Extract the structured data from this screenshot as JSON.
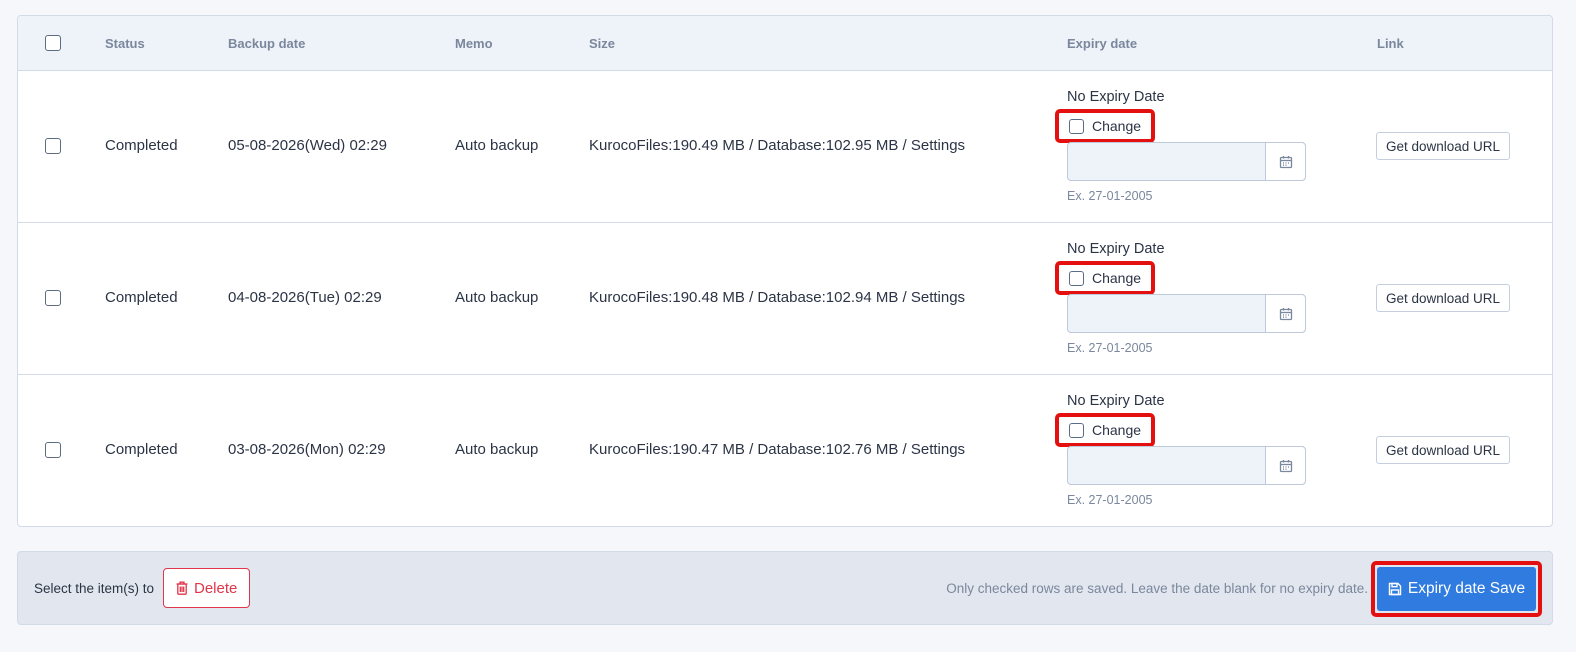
{
  "table": {
    "headers": {
      "status": "Status",
      "backup_date": "Backup date",
      "memo": "Memo",
      "size": "Size",
      "expiry_date": "Expiry date",
      "link": "Link"
    },
    "rows": [
      {
        "status": "Completed",
        "backup_date": "05-08-2026(Wed) 02:29",
        "memo": "Auto backup",
        "size": "KurocoFiles:190.49 MB / Database:102.95 MB / Settings",
        "expiry_text": "No Expiry Date",
        "change_label": "Change",
        "date_value": "",
        "example": "Ex. 27-01-2005",
        "link_label": "Get download URL"
      },
      {
        "status": "Completed",
        "backup_date": "04-08-2026(Tue) 02:29",
        "memo": "Auto backup",
        "size": "KurocoFiles:190.48 MB / Database:102.94 MB / Settings",
        "expiry_text": "No Expiry Date",
        "change_label": "Change",
        "date_value": "",
        "example": "Ex. 27-01-2005",
        "link_label": "Get download URL"
      },
      {
        "status": "Completed",
        "backup_date": "03-08-2026(Mon) 02:29",
        "memo": "Auto backup",
        "size": "KurocoFiles:190.47 MB / Database:102.76 MB / Settings",
        "expiry_text": "No Expiry Date",
        "change_label": "Change",
        "date_value": "",
        "example": "Ex. 27-01-2005",
        "link_label": "Get download URL"
      }
    ]
  },
  "footer": {
    "select_label": "Select the item(s) to",
    "delete_label": "Delete",
    "hint": "Only checked rows are saved. Leave the date blank for no expiry date.",
    "save_label": "Expiry date Save"
  },
  "icons": {
    "delete": "trash-icon",
    "save": "floppy-disk-icon",
    "calendar": "calendar-icon"
  },
  "colors": {
    "primary": "#2f7be0",
    "danger": "#e0364c",
    "highlight": "#e41010"
  }
}
